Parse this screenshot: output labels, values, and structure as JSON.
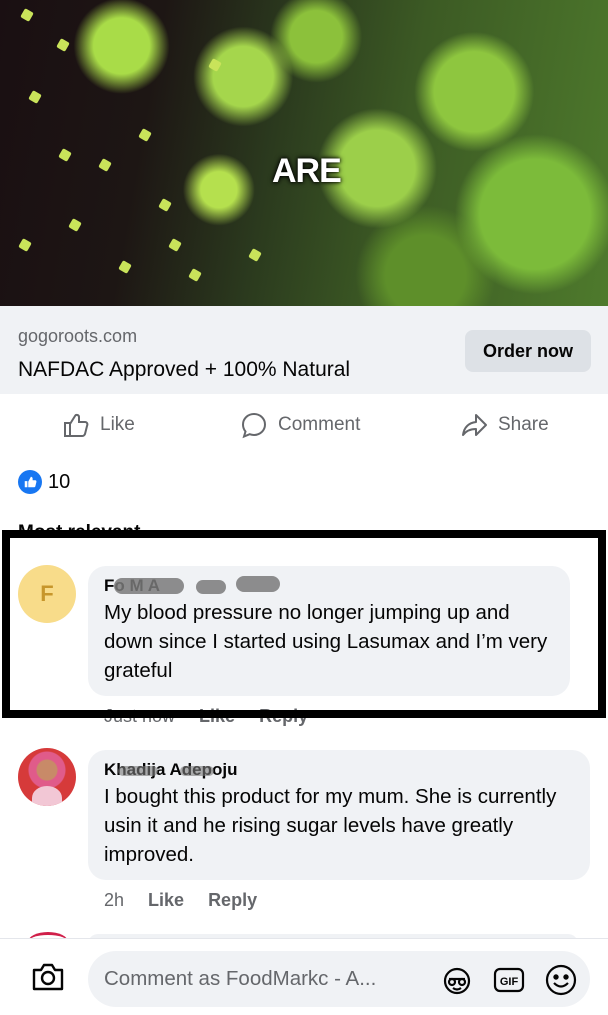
{
  "ad": {
    "caption": "ARE",
    "domain": "gogoroots.com",
    "headline": "NAFDAC Approved + 100% Natural",
    "cta_label": "Order now"
  },
  "actions": {
    "like": "Like",
    "comment": "Comment",
    "share": "Share"
  },
  "reactions": {
    "count": "10"
  },
  "sort_label": "Most relevant",
  "comments": [
    {
      "avatar_initial": "F",
      "name": "Fo   M   A   ",
      "text": "My blood pressure no longer jumping up and down since I started using Lasumax and I’m very grateful",
      "time": "Just now",
      "like": "Like",
      "reply": "Reply"
    },
    {
      "name": "Khadija Adepoju",
      "text": "I bought this product for my mum. She is currently usin it and he rising sugar levels have greatly improved.",
      "time": "2h",
      "like": "Like",
      "reply": "Reply"
    }
  ],
  "composer": {
    "placeholder": "Comment as FoodMarkc - A..."
  },
  "colors": {
    "facebook_blue": "#1877f2",
    "bubble_bg": "#f0f2f5",
    "secondary_text": "#65676b"
  },
  "icons": [
    "thumbs-up-icon",
    "comment-icon",
    "share-icon",
    "like-reaction-icon",
    "camera-icon",
    "avatar-sticker-icon",
    "gif-icon",
    "emoji-icon"
  ]
}
